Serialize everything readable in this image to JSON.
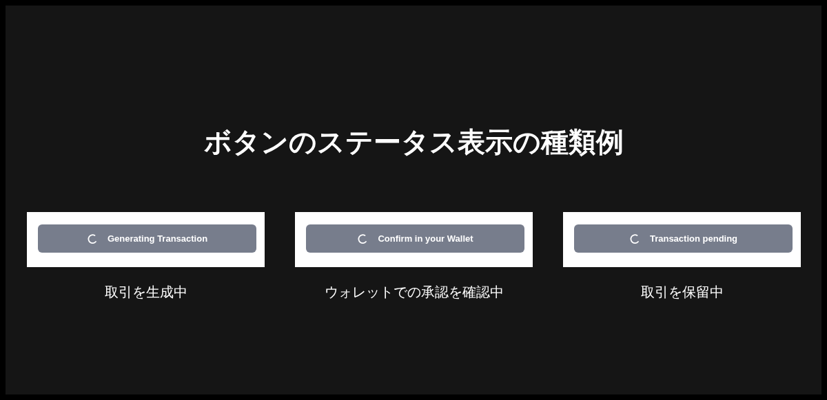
{
  "title": "ボタンのステータス表示の種類例",
  "examples": [
    {
      "button": "Generating Transaction",
      "caption": "取引を生成中"
    },
    {
      "button": "Confirm in your Wallet",
      "caption": "ウォレットでの承認を確認中"
    },
    {
      "button": "Transaction pending",
      "caption": "取引を保留中"
    }
  ]
}
